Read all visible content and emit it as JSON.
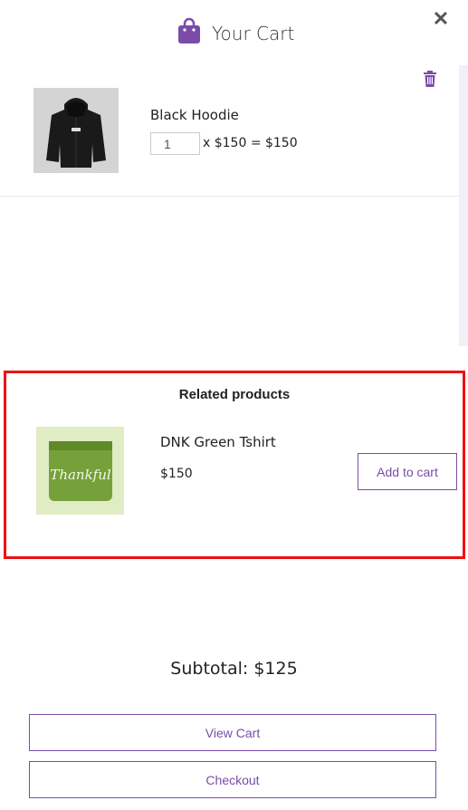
{
  "header": {
    "title": "Your Cart",
    "close_symbol": "✕",
    "bag_icon": "shopping-bag-icon",
    "accent": "#7a4ca8"
  },
  "cart": {
    "items": [
      {
        "name": "Black Hoodie",
        "quantity": "1",
        "price_line": "x $150 = $150",
        "image_icon": "black-hoodie-image"
      }
    ]
  },
  "related": {
    "heading": "Related products",
    "products": [
      {
        "name": "DNK Green Tshirt",
        "price": "$150",
        "shirt_text": "Thankful",
        "add_label": "Add to cart"
      }
    ]
  },
  "subtotal": "Subtotal: $125",
  "buttons": {
    "view_cart": "View Cart",
    "checkout": "Checkout"
  }
}
